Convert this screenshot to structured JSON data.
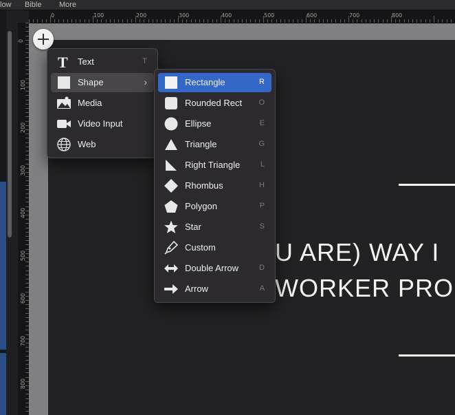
{
  "menubar": {
    "items": [
      "low",
      "Bible",
      "More"
    ]
  },
  "rulers": {
    "top_labels": [
      "0",
      "100",
      "200",
      "300",
      "400",
      "500",
      "600",
      "700",
      "800"
    ],
    "left_labels": [
      "0",
      "100",
      "200",
      "300",
      "400",
      "500",
      "600",
      "700",
      "800"
    ]
  },
  "slide": {
    "line1": "U ARE) WAY I",
    "line2": "WORKER PRO"
  },
  "add_button": {
    "icon": "plus-icon"
  },
  "main_menu": {
    "items": [
      {
        "label": "Text",
        "shortcut": "T",
        "icon": "text-icon"
      },
      {
        "label": "Shape",
        "shortcut": "",
        "icon": "shape-icon",
        "submenu": true
      },
      {
        "label": "Media",
        "shortcut": "",
        "icon": "media-icon"
      },
      {
        "label": "Video Input",
        "shortcut": "",
        "icon": "video-icon"
      },
      {
        "label": "Web",
        "shortcut": "",
        "icon": "globe-icon"
      }
    ],
    "highlighted": "Shape"
  },
  "shape_menu": {
    "items": [
      {
        "label": "Rectangle",
        "shortcut": "R",
        "icon": "rectangle-icon"
      },
      {
        "label": "Rounded Rect",
        "shortcut": "O",
        "icon": "rounded-rect-icon"
      },
      {
        "label": "Ellipse",
        "shortcut": "E",
        "icon": "ellipse-icon"
      },
      {
        "label": "Triangle",
        "shortcut": "G",
        "icon": "triangle-icon"
      },
      {
        "label": "Right Triangle",
        "shortcut": "L",
        "icon": "right-triangle-icon"
      },
      {
        "label": "Rhombus",
        "shortcut": "H",
        "icon": "rhombus-icon"
      },
      {
        "label": "Polygon",
        "shortcut": "P",
        "icon": "polygon-icon"
      },
      {
        "label": "Star",
        "shortcut": "S",
        "icon": "star-icon"
      },
      {
        "label": "Custom",
        "shortcut": "",
        "icon": "pen-icon"
      },
      {
        "label": "Double Arrow",
        "shortcut": "D",
        "icon": "double-arrow-icon"
      },
      {
        "label": "Arrow",
        "shortcut": "A",
        "icon": "arrow-icon"
      }
    ],
    "selected": "Rectangle"
  },
  "colors": {
    "accent": "#3467c7",
    "menu_bg": "#2c2a2e",
    "canvas": "#808083",
    "slide": "#222224"
  }
}
